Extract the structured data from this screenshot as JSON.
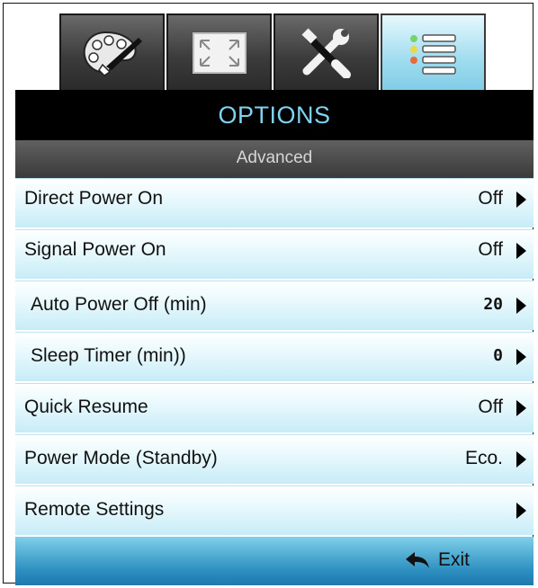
{
  "tabs": [
    {
      "icon": "palette-icon",
      "active": false
    },
    {
      "icon": "screen-resize-icon",
      "active": false
    },
    {
      "icon": "tools-icon",
      "active": false
    },
    {
      "icon": "options-list-icon",
      "active": true
    }
  ],
  "header": {
    "title": "OPTIONS"
  },
  "subheader": {
    "title": "Advanced"
  },
  "rows": [
    {
      "label": "Direct Power On",
      "value": "Off"
    },
    {
      "label": "Signal Power On",
      "value": "Off"
    },
    {
      "label": "Auto Power Off  (min)",
      "value": "20"
    },
    {
      "label": "Sleep Timer (min))",
      "value": "0"
    },
    {
      "label": "Quick Resume",
      "value": "Off"
    },
    {
      "label": "Power Mode (Standby)",
      "value": "Eco."
    },
    {
      "label": "Remote Settings",
      "value": ""
    }
  ],
  "footer": {
    "exit_label": "Exit",
    "exit_icon": "return-arrow-icon"
  }
}
